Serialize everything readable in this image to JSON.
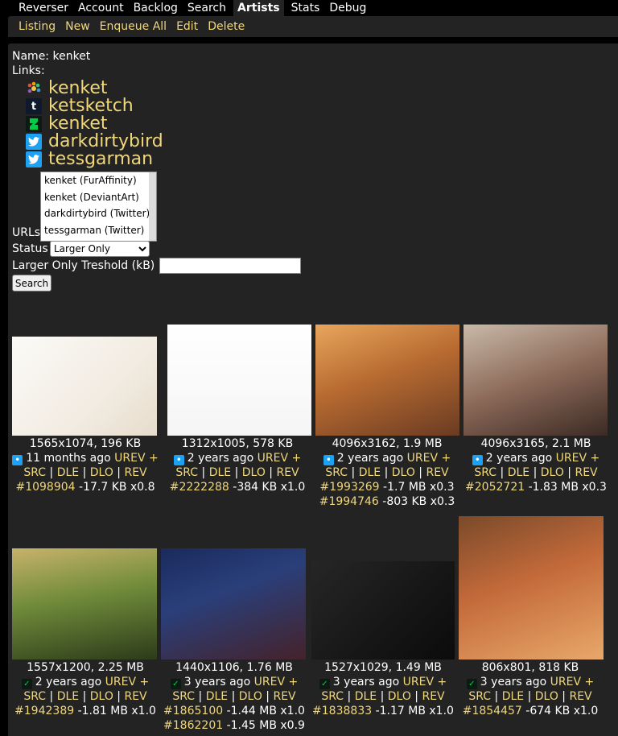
{
  "topnav": {
    "items": [
      "Reverser",
      "Account",
      "Backlog",
      "Search",
      "Artists",
      "Stats",
      "Debug"
    ],
    "active": "Artists"
  },
  "subnav": {
    "items": [
      "Listing",
      "New",
      "Enqueue All",
      "Edit",
      "Delete"
    ]
  },
  "artist": {
    "name_label": "Name:",
    "name": "kenket",
    "links_label": "Links:",
    "links": [
      {
        "site": "FurAffinity",
        "icon": "furaffinity-icon",
        "label": "kenket"
      },
      {
        "site": "Tumblr",
        "icon": "tumblr-icon",
        "label": "ketsketch"
      },
      {
        "site": "DeviantArt",
        "icon": "deviantart-icon",
        "label": "kenket"
      },
      {
        "site": "Twitter",
        "icon": "twitter-icon",
        "label": "darkdirtybird"
      },
      {
        "site": "Twitter",
        "icon": "twitter-icon",
        "label": "tessgarman"
      }
    ]
  },
  "form": {
    "url_listbox_options": [
      "kenket (FurAffinity)",
      "kenket (DeviantArt)",
      "darkdirtybird (Twitter)",
      "tessgarman (Twitter)"
    ],
    "urls_label": "URLs",
    "status_label": "Status",
    "status_value": "Larger Only",
    "threshold_label": "Larger Only Treshold (kB)",
    "threshold_value": "",
    "search_button": "Search"
  },
  "results": [
    {
      "dims": "1565x1074, 196 KB",
      "source": "twitter-icon",
      "age": "11 months ago",
      "urev": "UREV +",
      "actions": [
        "SRC",
        "DLE",
        "DLO",
        "REV"
      ],
      "matches": [
        {
          "id": "#1098904",
          "diff": "-17.7 KB x0.8"
        }
      ]
    },
    {
      "dims": "1312x1005, 578 KB",
      "source": "twitter-icon",
      "age": "2 years ago",
      "urev": "UREV +",
      "actions": [
        "SRC",
        "DLE",
        "DLO",
        "REV"
      ],
      "matches": [
        {
          "id": "#2222288",
          "diff": "-384 KB x1.0"
        }
      ]
    },
    {
      "dims": "4096x3162, 1.9 MB",
      "source": "twitter-icon",
      "age": "2 years ago",
      "urev": "UREV +",
      "actions": [
        "SRC",
        "DLE",
        "DLO",
        "REV"
      ],
      "matches": [
        {
          "id": "#1993269",
          "diff": "-1.7 MB x0.3"
        },
        {
          "id": "#1994746",
          "diff": "-803 KB x0.3"
        }
      ]
    },
    {
      "dims": "4096x3165, 2.1 MB",
      "source": "twitter-icon",
      "age": "2 years ago",
      "urev": "UREV +",
      "actions": [
        "SRC",
        "DLE",
        "DLO",
        "REV"
      ],
      "matches": [
        {
          "id": "#2052721",
          "diff": "-1.83 MB x0.3"
        }
      ]
    },
    {
      "dims": "1557x1200, 2.25 MB",
      "source": "deviantart-icon",
      "age": "2 years ago",
      "urev": "UREV +",
      "actions": [
        "SRC",
        "DLE",
        "DLO",
        "REV"
      ],
      "matches": [
        {
          "id": "#1942389",
          "diff": "-1.81 MB x1.0"
        }
      ]
    },
    {
      "dims": "1440x1106, 1.76 MB",
      "source": "deviantart-icon",
      "age": "3 years ago",
      "urev": "UREV +",
      "actions": [
        "SRC",
        "DLE",
        "DLO",
        "REV"
      ],
      "matches": [
        {
          "id": "#1865100",
          "diff": "-1.44 MB x1.0"
        },
        {
          "id": "#1862201",
          "diff": "-1.45 MB x0.9"
        }
      ]
    },
    {
      "dims": "1527x1029, 1.49 MB",
      "source": "deviantart-icon",
      "age": "3 years ago",
      "urev": "UREV +",
      "actions": [
        "SRC",
        "DLE",
        "DLO",
        "REV"
      ],
      "matches": [
        {
          "id": "#1838833",
          "diff": "-1.17 MB x1.0"
        }
      ]
    },
    {
      "dims": "806x801, 818 KB",
      "source": "deviantart-icon",
      "age": "3 years ago",
      "urev": "UREV +",
      "actions": [
        "SRC",
        "DLE",
        "DLO",
        "REV"
      ],
      "matches": [
        {
          "id": "#1854457",
          "diff": "-674 KB x1.0"
        }
      ]
    }
  ],
  "colors": {
    "accent": "#f0d77a",
    "panel": "#232323",
    "background": "#000000"
  }
}
